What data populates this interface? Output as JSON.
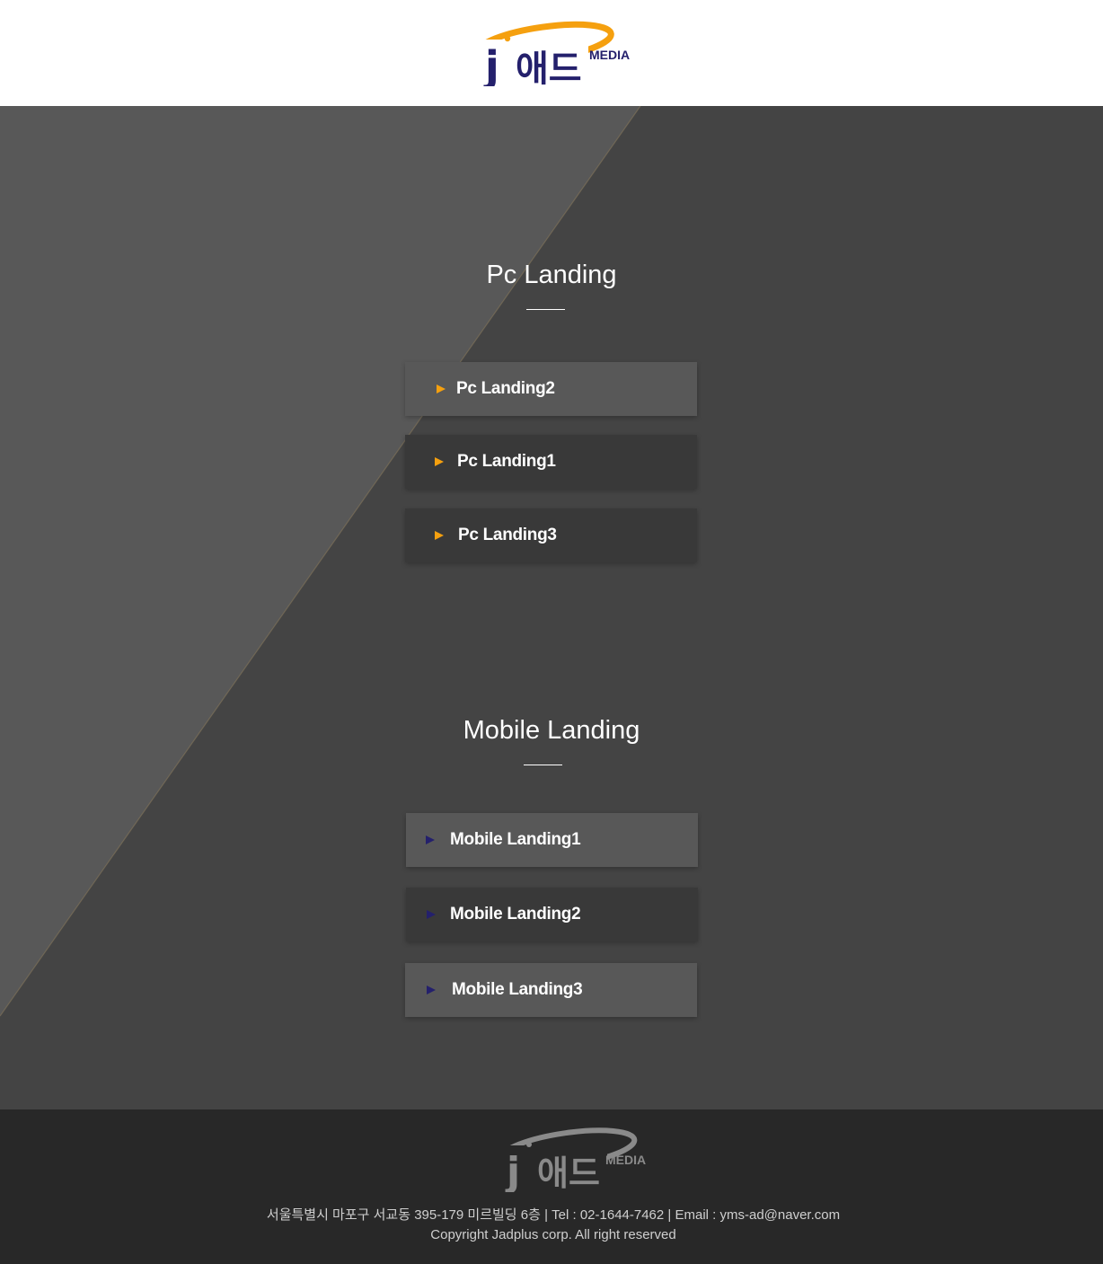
{
  "header": {
    "logo": {
      "mark": "j",
      "korean": "애드",
      "media": "MEDIA"
    }
  },
  "colors": {
    "accent": "#f5a00f",
    "navy": "#24206c",
    "light_button": "#585858",
    "dark_button": "#393939",
    "background": "#444444",
    "footer": "#282828"
  },
  "pc_section": {
    "title": "Pc Landing",
    "buttons": [
      {
        "label": "Pc  Landing2",
        "icon": "play-triangle-icon"
      },
      {
        "label": "Pc  Landing1",
        "icon": "play-triangle-icon"
      },
      {
        "label": "Pc  Landing3",
        "icon": "play-triangle-icon"
      }
    ]
  },
  "mobile_section": {
    "title": "Mobile Landing",
    "buttons": [
      {
        "label": "Mobile Landing1",
        "icon": "play-triangle-icon"
      },
      {
        "label": "Mobile Landing2",
        "icon": "play-triangle-icon"
      },
      {
        "label": "Mobile Landing3",
        "icon": "play-triangle-icon"
      }
    ]
  },
  "footer": {
    "logo": {
      "mark": "j",
      "korean": "애드",
      "media": "MEDIA"
    },
    "address": "서울특별시 마포구 서교동 395-179 미르빌딩 6층 | Tel : 02-1644-7462 | Email : yms-ad@naver.com",
    "copyright": "Copyright Jadplus corp. All right reserved"
  }
}
